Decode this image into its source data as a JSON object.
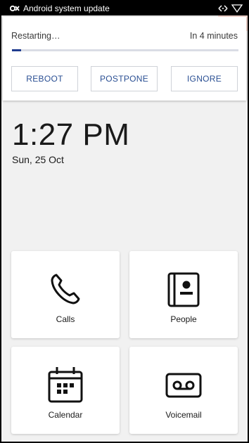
{
  "status_bar": {
    "notification_title": "Android system update",
    "icons": [
      "system-update-icon",
      "signal-icon",
      "wifi-icon"
    ]
  },
  "notification": {
    "status_text": "Restarting…",
    "countdown": "In 4 minutes",
    "progress_fraction": 0.04,
    "buttons": {
      "reboot": "REBOOT",
      "postpone": "POSTPONE",
      "ignore": "IGNORE"
    },
    "accent_color": "#1f3c8f"
  },
  "clock": {
    "time": "1:27 PM",
    "date": "Sun, 25 Oct"
  },
  "tiles": [
    {
      "label": "Calls",
      "icon": "phone-icon"
    },
    {
      "label": "People",
      "icon": "contacts-book-icon"
    },
    {
      "label": "Calendar",
      "icon": "calendar-icon"
    },
    {
      "label": "Voicemail",
      "icon": "voicemail-icon"
    }
  ]
}
